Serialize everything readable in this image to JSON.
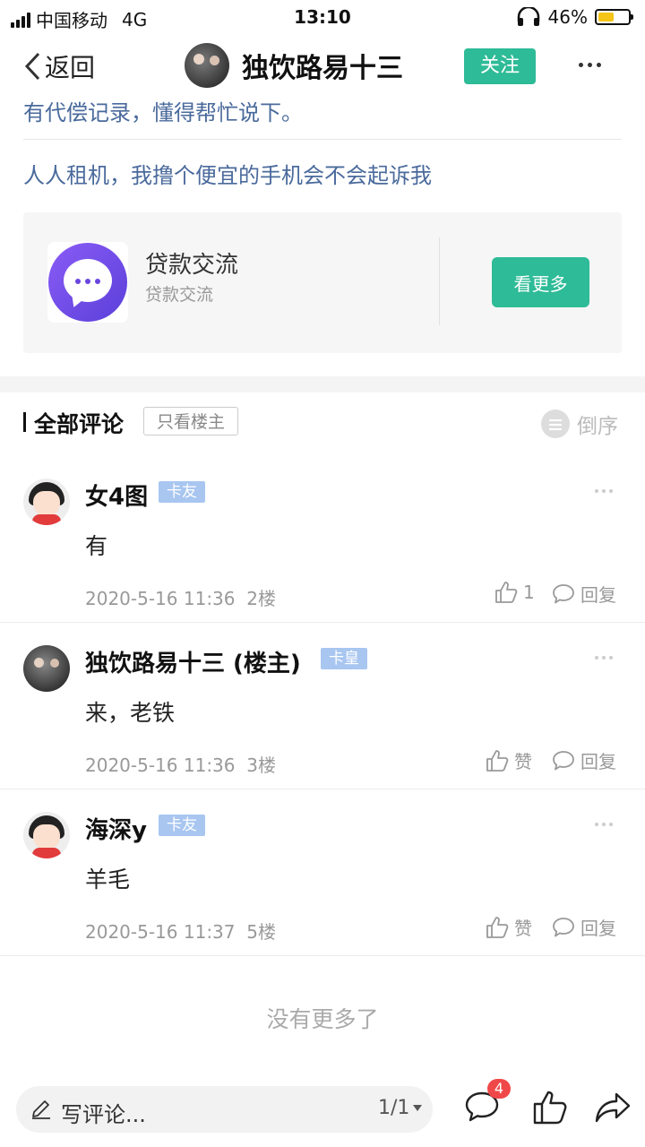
{
  "status_bar": {
    "carrier": "中国移动",
    "network": "4G",
    "time": "13:10",
    "battery_percent": "46%",
    "battery_level": 0.46
  },
  "nav": {
    "back_label": "返回",
    "title": "独饮路易十三",
    "follow_label": "关注"
  },
  "post": {
    "partial_link": "有代偿记录，懂得帮忙说下。",
    "link_text": "人人租机，我撸个便宜的手机会不会起诉我"
  },
  "group_card": {
    "name": "贷款交流",
    "subtitle": "贷款交流",
    "button_label": "看更多"
  },
  "comments_section": {
    "title": "全部评论",
    "only_op_label": "只看楼主",
    "sort_label": "倒序"
  },
  "comments": [
    {
      "name": "女4图",
      "badge": "卡友",
      "text": "有",
      "time": "2020-5-16 11:36",
      "floor": "2楼",
      "like_label": "1",
      "reply_label": "回复"
    },
    {
      "name": "独饮路易十三 (楼主)",
      "badge": "卡皇",
      "text": "来，老铁",
      "time": "2020-5-16 11:36",
      "floor": "3楼",
      "like_label": "赞",
      "reply_label": "回复"
    },
    {
      "name": "海深y",
      "badge": "卡友",
      "text": "羊毛",
      "time": "2020-5-16 11:37",
      "floor": "5楼",
      "like_label": "赞",
      "reply_label": "回复"
    }
  ],
  "no_more_text": "没有更多了",
  "bottom_bar": {
    "placeholder": "写评论...",
    "page_indicator": "1/1",
    "comment_count": "4"
  },
  "colors": {
    "accent_green": "#2ebb97",
    "link_blue": "#4a6a9c",
    "badge_blue": "#a8c6f0",
    "notification_red": "#f04848"
  }
}
